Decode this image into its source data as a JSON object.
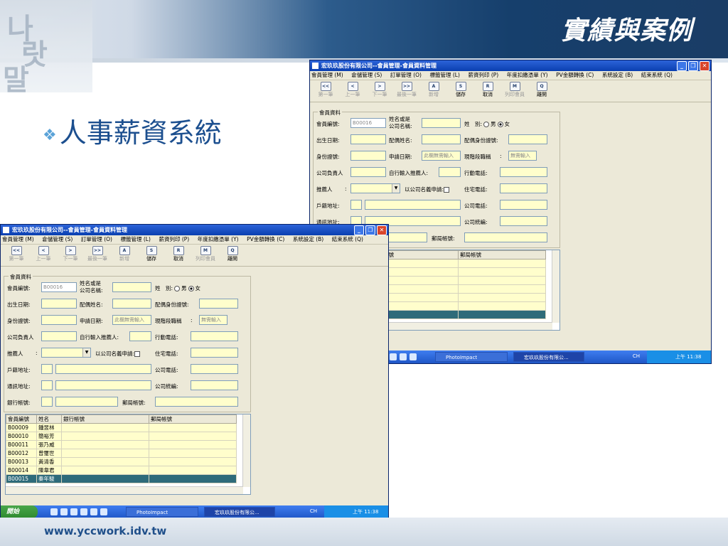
{
  "slide": {
    "title": "實績與案例",
    "bullet": "人事薪資系統",
    "footer_url": "www.yccwork.idv.tw",
    "bg_glyphs": [
      "나",
      "랏",
      "말"
    ]
  },
  "window": {
    "title": "宏玖玖股份有限公司--會員管理-會員資料管理",
    "title_buttons": [
      "_",
      "❐",
      "✕"
    ],
    "menu": [
      "會員管理 (M)",
      "倉儲管理 (S)",
      "訂單管理 (O)",
      "標籤管理 (L)",
      "薪資列印 (P)",
      "年度扣繳憑單 (Y)",
      "PV金額轉換 (C)",
      "系統設定 (B)",
      "結束系統 (Q)"
    ],
    "toolbar": [
      {
        "key": "<<",
        "label": "第一筆",
        "enabled": false
      },
      {
        "key": "<",
        "label": "上一筆",
        "enabled": false
      },
      {
        "key": ">",
        "label": "下一筆",
        "enabled": false
      },
      {
        "key": ">>",
        "label": "最後一筆",
        "enabled": false
      },
      {
        "key": "A",
        "label": "新增",
        "enabled": false
      },
      {
        "key": "S",
        "label": "儲存",
        "enabled": true
      },
      {
        "key": "R",
        "label": "取消",
        "enabled": true
      },
      {
        "key": "M",
        "label": "列印會員",
        "enabled": false
      },
      {
        "key": "Q",
        "label": "離開",
        "enabled": true
      }
    ],
    "form": {
      "legend": "會員資料",
      "member_no_label": "會員編號:",
      "member_no_value": "B00016",
      "name_label_1": "姓名或是",
      "name_label_2": "公司名稱:",
      "gender_label": "姓　別:",
      "gender_male": "男",
      "gender_female": "女",
      "birthday_label": "出生日期:",
      "spouse_name_label": "配偶姓名:",
      "spouse_id_label": "配偶身份證號:",
      "id_label": "身份證號:",
      "apply_date_label": "申請日期:",
      "apply_date_value": "此欄無需輸入",
      "rank_label": "現階段職稱",
      "rank_value": "無需輸入",
      "owner_label": "公司負責人",
      "self_referrer_label": "自行輸入推薦人:",
      "mobile_label": "行動電話:",
      "referrer_label": "推薦人",
      "company_apply_label": "以公司名義申請:",
      "home_phone_label": "住宅電話:",
      "reg_addr_label": "戶籍地址:",
      "company_phone_label": "公司電話:",
      "mail_addr_label": "通訊地址:",
      "tax_id_label": "公司統編:",
      "bank_label": "銀行帳號:",
      "post_label": "郵局帳號:"
    },
    "grid": {
      "columns": [
        "會員編號",
        "姓名",
        "銀行帳號",
        "郵局帳號"
      ],
      "rows": [
        [
          "B00009",
          "鍾昱林",
          "",
          ""
        ],
        [
          "B00010",
          "簡裕芳",
          "",
          ""
        ],
        [
          "B00011",
          "張乃威",
          "",
          ""
        ],
        [
          "B00012",
          "曾璽世",
          "",
          ""
        ],
        [
          "B00013",
          "黃清香",
          "",
          ""
        ],
        [
          "B00014",
          "陳韋君",
          "",
          ""
        ],
        [
          "B00015",
          "秦年駿",
          "",
          ""
        ]
      ],
      "selected_index": 6
    },
    "taskbar": {
      "start": "開始",
      "items": [
        "PhotoImpact",
        "宏玖玖股份有限公..."
      ],
      "lang": "CH",
      "clock": "上午 11:38"
    }
  }
}
